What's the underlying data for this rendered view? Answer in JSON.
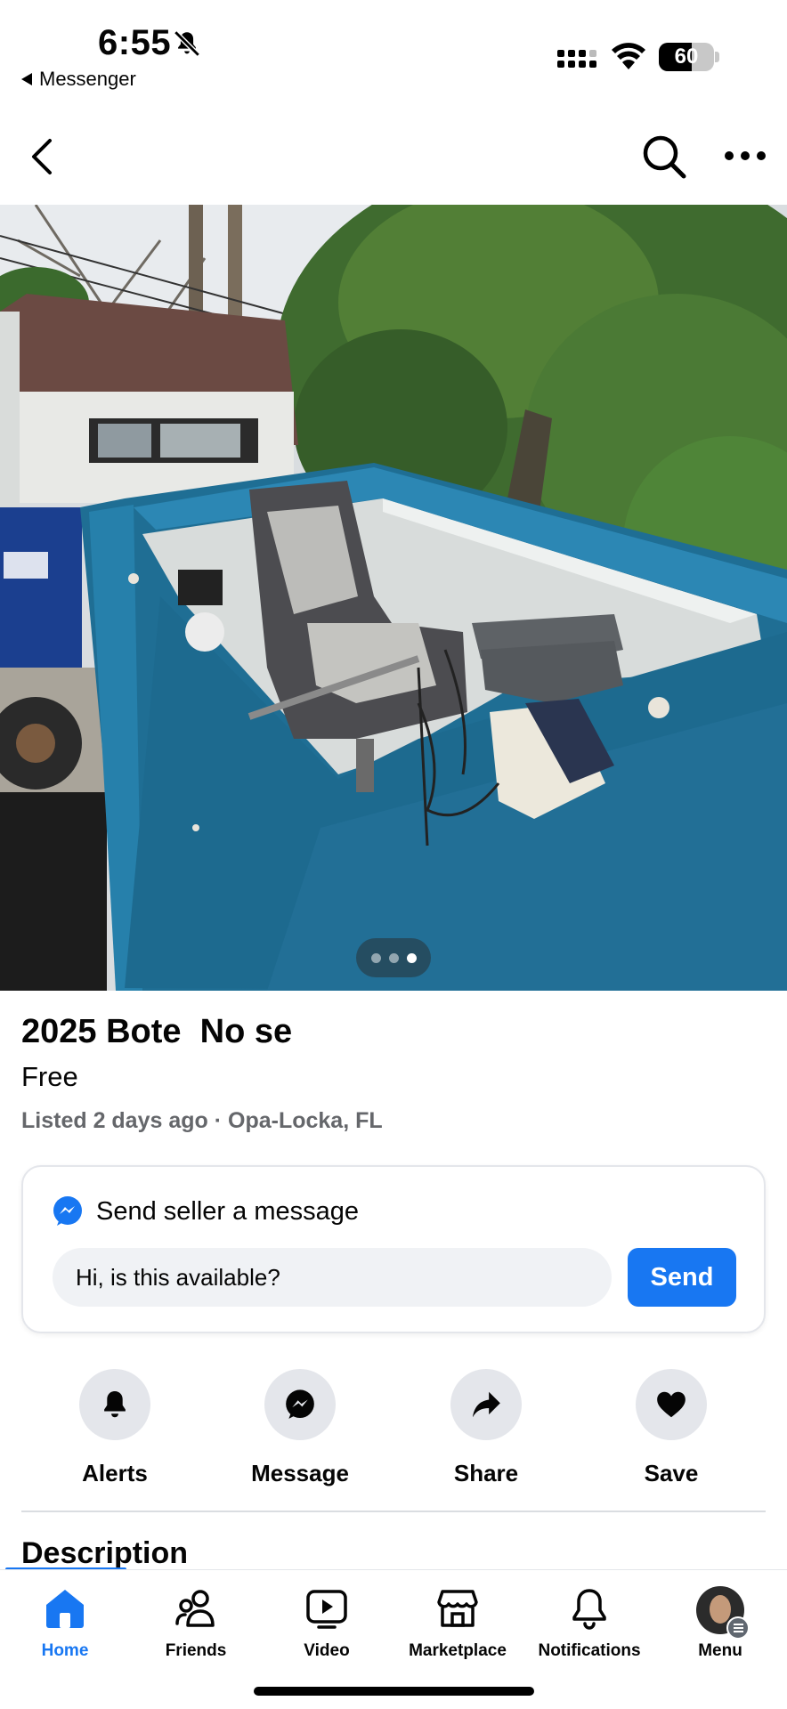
{
  "status_bar": {
    "time": "6:55",
    "back_app": "Messenger",
    "battery": "60",
    "battery_level": 0.6
  },
  "header": {
    "back_icon": "chevron-left-icon",
    "search_icon": "search-icon",
    "more_icon": "more-horizontal-icon"
  },
  "photo": {
    "page_count": 3,
    "current_page": 3
  },
  "listing": {
    "title": "2025 Bote  No se",
    "price": "Free",
    "meta": "Listed 2 days ago · Opa-Locka, FL"
  },
  "message_card": {
    "heading": "Send seller a message",
    "input_value": "Hi, is this available?",
    "send_label": "Send"
  },
  "actions": [
    {
      "label": "Alerts",
      "icon": "bell-icon"
    },
    {
      "label": "Message",
      "icon": "messenger-icon"
    },
    {
      "label": "Share",
      "icon": "share-arrow-icon"
    },
    {
      "label": "Save",
      "icon": "heart-icon"
    }
  ],
  "description": {
    "heading": "Description"
  },
  "tabbar": {
    "items": [
      {
        "label": "Home",
        "icon": "home-icon",
        "active": true
      },
      {
        "label": "Friends",
        "icon": "friends-icon"
      },
      {
        "label": "Video",
        "icon": "video-icon"
      },
      {
        "label": "Marketplace",
        "icon": "marketplace-icon"
      },
      {
        "label": "Notifications",
        "icon": "bell-icon"
      },
      {
        "label": "Menu",
        "icon": "avatar"
      }
    ]
  },
  "colors": {
    "accent": "#1877f2",
    "secondary_text": "#65676b",
    "boat_blue": "#1f6e94"
  }
}
